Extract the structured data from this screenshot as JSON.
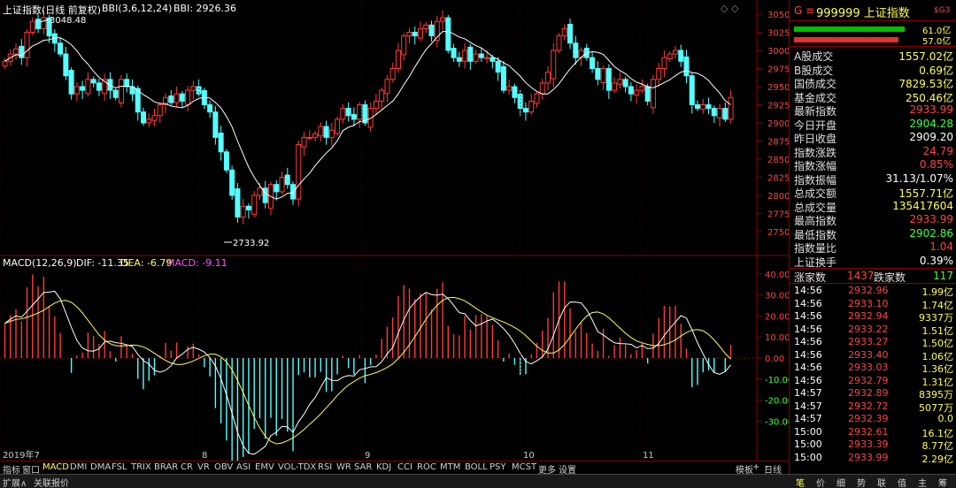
{
  "header": {
    "index_name": "上证指数(日线 前复权)",
    "bbi_label": "BBI(3,6,12,24)",
    "bbi_value_label": "BBI: 2926.36",
    "win_controls": "◇ ◇"
  },
  "macd_header": {
    "name": "MACD(12,26,9)",
    "dif": "DIF: -11.35",
    "dea": "DEA: -6.79",
    "macd": "MACD: -9.11"
  },
  "price_axis": [
    "3050",
    "3025",
    "3000",
    "2975",
    "2950",
    "2925",
    "2900",
    "2875",
    "2850",
    "2825",
    "2800",
    "2775",
    "2750"
  ],
  "macd_axis": [
    "40.00",
    "30.00",
    "20.00",
    "10.00",
    "0.00",
    "-10.00",
    "-20.00",
    "-30.00"
  ],
  "annotations": {
    "high": "3048.48",
    "low": "2733.92"
  },
  "date_labels": [
    "2019年7",
    "8",
    "9",
    "10",
    "11"
  ],
  "right_panel": {
    "code_prefix": "G ≡",
    "code": "999999 上证指数",
    "badge": "$G3",
    "bar1_value": "61.0亿",
    "bar2_value": "57.0亿",
    "stats": [
      {
        "k": "A股成交",
        "v": "1557.02亿",
        "c": "#ffff55"
      },
      {
        "k": "B股成交",
        "v": "0.69亿",
        "c": "#ffff55"
      },
      {
        "k": "国债成交",
        "v": "7829.53亿",
        "c": "#ffff55"
      },
      {
        "k": "基金成交",
        "v": "250.46亿",
        "c": "#ffff55"
      },
      {
        "k": "最新指数",
        "v": "2933.99",
        "c": "#ff4444"
      },
      {
        "k": "今日开盘",
        "v": "2904.28",
        "c": "#44ff44"
      },
      {
        "k": "昨日收盘",
        "v": "2909.20",
        "c": "#ffffff"
      },
      {
        "k": "指数涨跌",
        "v": "24.79",
        "c": "#ff4444"
      },
      {
        "k": "指数涨幅",
        "v": "0.85%",
        "c": "#ff4444"
      },
      {
        "k": "指数振幅",
        "v": "31.13/1.07%",
        "c": "#ffffff"
      },
      {
        "k": "总成交额",
        "v": "1557.71亿",
        "c": "#ffff55"
      },
      {
        "k": "总成交量",
        "v": "135417604",
        "c": "#ffff55"
      },
      {
        "k": "最高指数",
        "v": "2933.99",
        "c": "#ff4444"
      },
      {
        "k": "最低指数",
        "v": "2902.86",
        "c": "#44ff44"
      },
      {
        "k": "指数量比",
        "v": "1.04",
        "c": "#ff4444"
      },
      {
        "k": "上证换手",
        "v": "0.39%",
        "c": "#ffffff"
      }
    ],
    "advance_label": "涨家数",
    "advance": "1437",
    "decline_label": "跌家数",
    "decline": "117",
    "ticks": [
      {
        "t": "14:56",
        "p": "2932.96",
        "v": "1.99亿"
      },
      {
        "t": "14:56",
        "p": "2933.10",
        "v": "1.74亿"
      },
      {
        "t": "14:56",
        "p": "2932.94",
        "v": "9337万"
      },
      {
        "t": "14:56",
        "p": "2933.22",
        "v": "1.51亿"
      },
      {
        "t": "14:56",
        "p": "2933.27",
        "v": "1.50亿"
      },
      {
        "t": "14:56",
        "p": "2933.40",
        "v": "1.06亿"
      },
      {
        "t": "14:56",
        "p": "2933.03",
        "v": "1.36亿"
      },
      {
        "t": "14:56",
        "p": "2932.79",
        "v": "1.31亿"
      },
      {
        "t": "14:57",
        "p": "2932.89",
        "v": "8395万"
      },
      {
        "t": "14:57",
        "p": "2932.72",
        "v": "5077万"
      },
      {
        "t": "14:57",
        "p": "2932.39",
        "v": "0.0"
      },
      {
        "t": "15:00",
        "p": "2932.61",
        "v": "16.1亿"
      },
      {
        "t": "15:00",
        "p": "2933.39",
        "v": "8.77亿"
      },
      {
        "t": "15:00",
        "p": "2933.99",
        "v": "2.29亿"
      }
    ],
    "bottom_tabs": [
      "笔",
      "价",
      "细",
      "势",
      "联",
      "值",
      "主",
      "筹"
    ]
  },
  "tabs": [
    "指标",
    "窗口",
    "MACD",
    "DMI",
    "DMA",
    "FSL",
    "TRIX",
    "BRAR",
    "CR",
    "VR",
    "OBV",
    "ASI",
    "EMV",
    "VOL-TDX",
    "RSI",
    "WR",
    "SAR",
    "KDJ",
    "CCI",
    "ROC",
    "MTM",
    "BOLL",
    "PSY",
    "MCST",
    "更多",
    "设置"
  ],
  "tabs_right": [
    "模板",
    "日线"
  ],
  "status": [
    "扩展∧",
    "关联报价"
  ],
  "colors": {
    "up": "#ff3b3b",
    "down": "#54ffff",
    "grid": "#8b0000",
    "line": "#ffffff",
    "yellow": "#ffff55"
  }
}
